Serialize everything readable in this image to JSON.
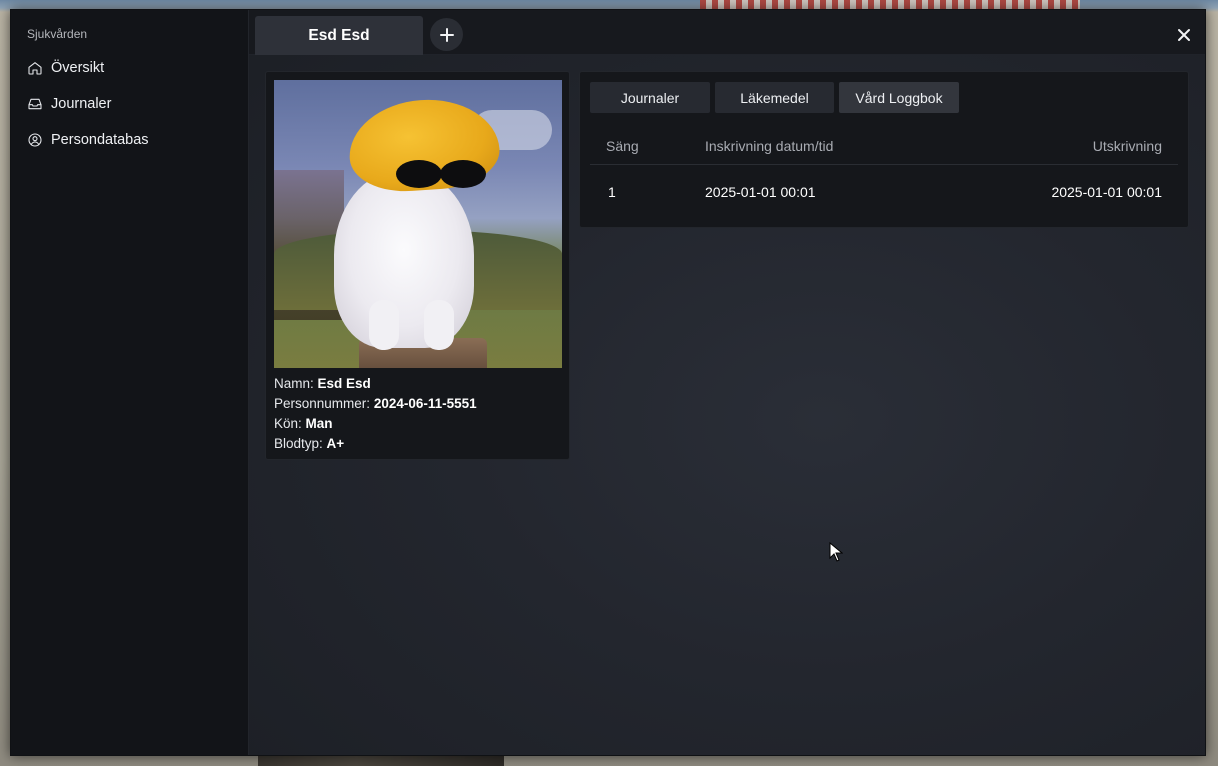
{
  "sidebar": {
    "title": "Sjukvården",
    "items": [
      {
        "label": "Översikt",
        "icon": "home-icon"
      },
      {
        "label": "Journaler",
        "icon": "inbox-icon"
      },
      {
        "label": "Persondatabas",
        "icon": "user-circle-icon"
      }
    ]
  },
  "header": {
    "active_tab": "Esd Esd",
    "add_tab_icon": "plus-icon",
    "close_icon": "close-icon"
  },
  "profile": {
    "photo_alt": "cat wearing yellow hat and sunglasses",
    "fields": [
      {
        "label": "Namn:",
        "value": "Esd Esd"
      },
      {
        "label": "Personnummer:",
        "value": "2024-06-11-5551"
      },
      {
        "label": "Kön:",
        "value": "Man"
      },
      {
        "label": "Blodtyp:",
        "value": "A+"
      }
    ]
  },
  "records": {
    "tabs": [
      "Journaler",
      "Läkemedel",
      "Vård Loggbok"
    ],
    "active_tab": "Vård Loggbok",
    "columns": [
      "Säng",
      "Inskrivning datum/tid",
      "Utskrivning"
    ],
    "rows": [
      [
        "1",
        "2025-01-01 00:01",
        "2025-01-01 00:01"
      ]
    ]
  },
  "colors": {
    "window_bg": "#1d2027",
    "sidebar_bg": "#121418",
    "card_bg": "#15171b",
    "tab_bg": "#272a31"
  }
}
